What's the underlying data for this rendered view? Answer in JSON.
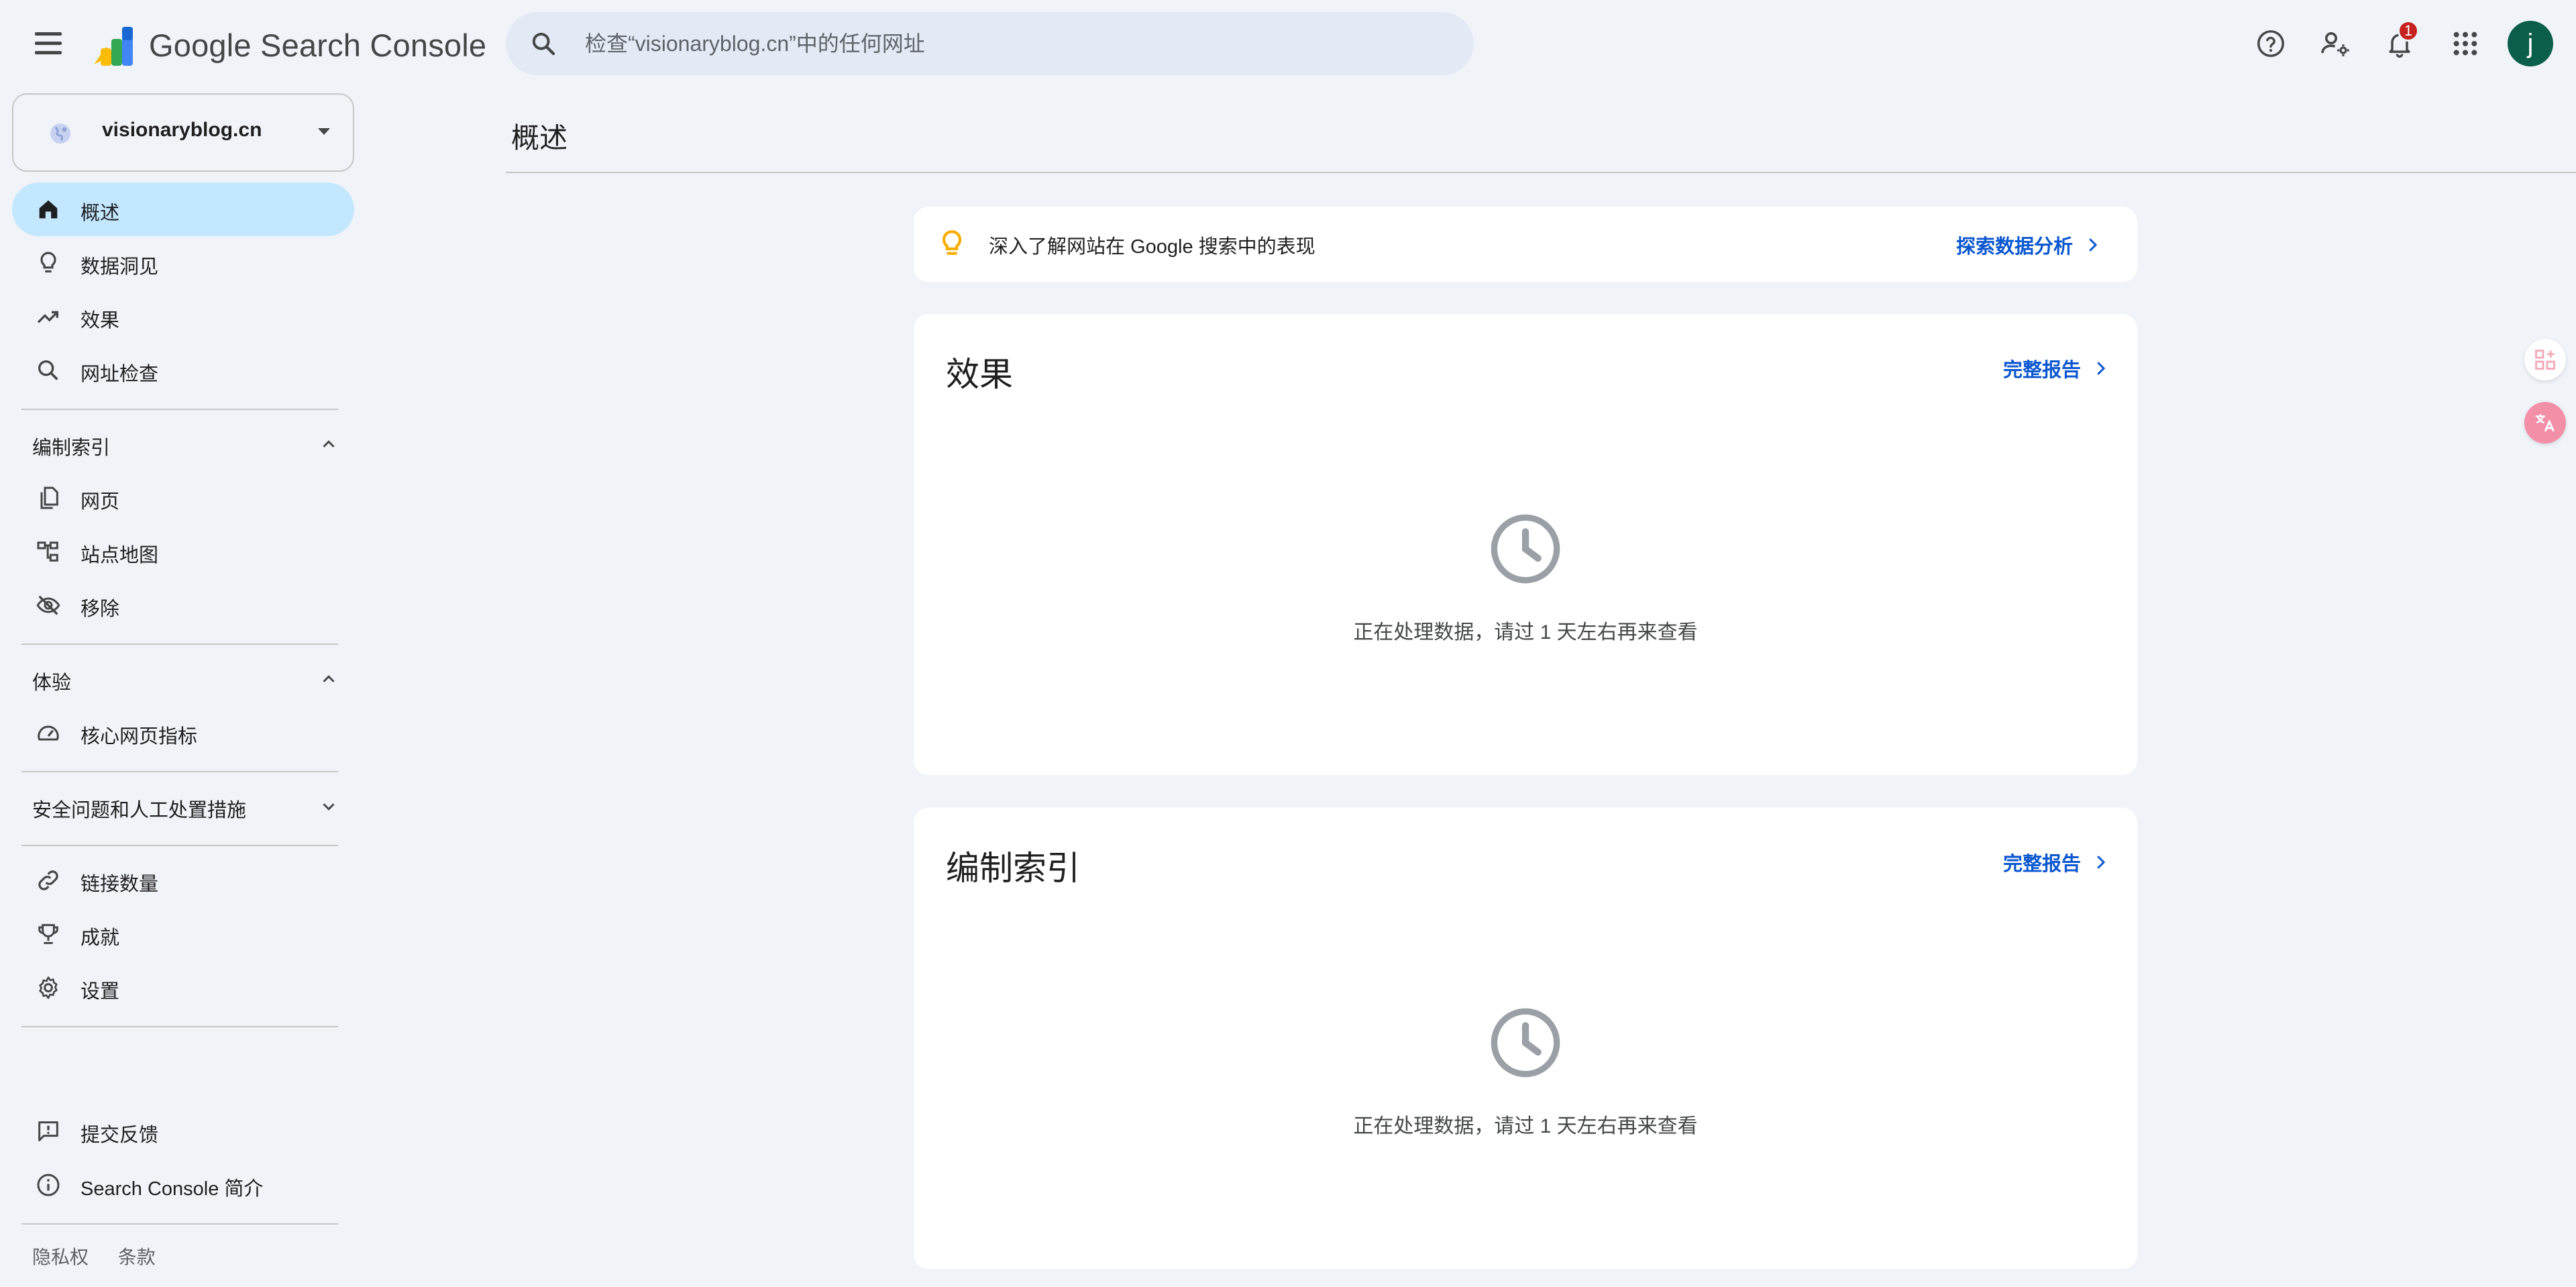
{
  "header": {
    "brand": "Google Search Console",
    "search_placeholder": "检查“visionaryblog.cn”中的任何网址",
    "notification_count": "1",
    "avatar_letter": "j"
  },
  "sidebar": {
    "property": "visionaryblog.cn",
    "items_top": [
      {
        "label": "概述",
        "icon": "home-icon",
        "active": true
      },
      {
        "label": "数据洞见",
        "icon": "lightbulb-icon"
      },
      {
        "label": "效果",
        "icon": "trending-up-icon"
      },
      {
        "label": "网址检查",
        "icon": "search-icon"
      }
    ],
    "sections": [
      {
        "title": "编制索引",
        "expanded": true,
        "items": [
          {
            "label": "网页",
            "icon": "pages-icon"
          },
          {
            "label": "站点地图",
            "icon": "sitemap-icon"
          },
          {
            "label": "移除",
            "icon": "visibility-off-icon"
          }
        ]
      },
      {
        "title": "体验",
        "expanded": true,
        "items": [
          {
            "label": "核心网页指标",
            "icon": "speed-icon"
          }
        ]
      },
      {
        "title": "安全问题和人工处置措施",
        "expanded": false,
        "items": []
      }
    ],
    "items_bottom": [
      {
        "label": "链接数量",
        "icon": "link-icon"
      },
      {
        "label": "成就",
        "icon": "trophy-icon"
      },
      {
        "label": "设置",
        "icon": "gear-icon"
      }
    ],
    "items_footer": [
      {
        "label": "提交反馈",
        "icon": "feedback-icon"
      },
      {
        "label": "Search Console 简介",
        "icon": "info-icon"
      }
    ],
    "footer_links": [
      "隐私权",
      "条款"
    ]
  },
  "main": {
    "page_title": "概述",
    "insight_text": "深入了解网站在 Google 搜索中的表现",
    "insight_link": "探索数据分析",
    "cards": [
      {
        "title": "效果",
        "link": "完整报告",
        "message": "正在处理数据，请过 1 天左右再来查看"
      },
      {
        "title": "编制索引",
        "link": "完整报告",
        "message": "正在处理数据，请过 1 天左右再来查看"
      }
    ]
  },
  "colors": {
    "background": "#f0f4f9",
    "active_nav": "#c2e7ff",
    "link": "#0b57d0",
    "avatar": "#0b5f4a",
    "badge": "#c5221f"
  }
}
